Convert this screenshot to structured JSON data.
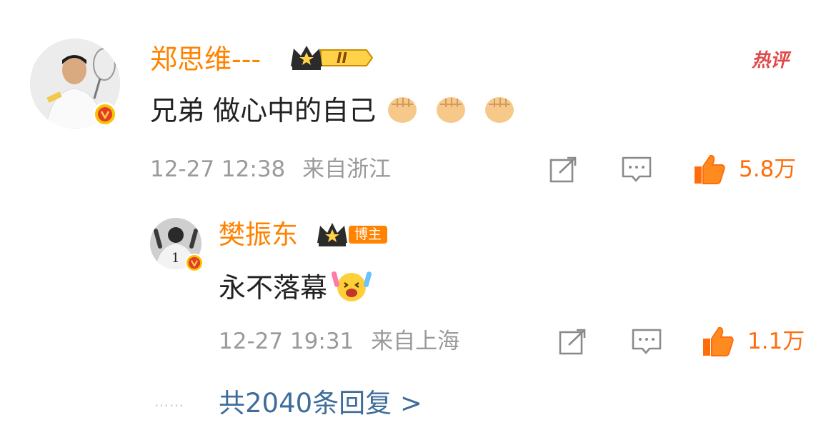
{
  "hot_label": "热评",
  "comment": {
    "author": "郑思维---",
    "level_badge": "II",
    "text": "兄弟 做心中的自己",
    "emoji": [
      "fist-emoji",
      "fist-emoji",
      "fist-emoji"
    ],
    "time": "12-27 12:38",
    "location": "来自浙江",
    "likes": "5.8万",
    "verified": true
  },
  "reply": {
    "author": "樊振东",
    "host_badge": "博主",
    "text": "永不落幕",
    "emoji": [
      "cheer-emoji"
    ],
    "time": "12-27 19:31",
    "location": "来自上海",
    "likes": "1.1万",
    "verified": true
  },
  "more_replies": {
    "dots": "……",
    "label": "共2040条回复 >"
  },
  "colors": {
    "name": "#ff8200",
    "like": "#ff6d0b",
    "link": "#3f6d9a",
    "meta": "#9a9a9a"
  }
}
